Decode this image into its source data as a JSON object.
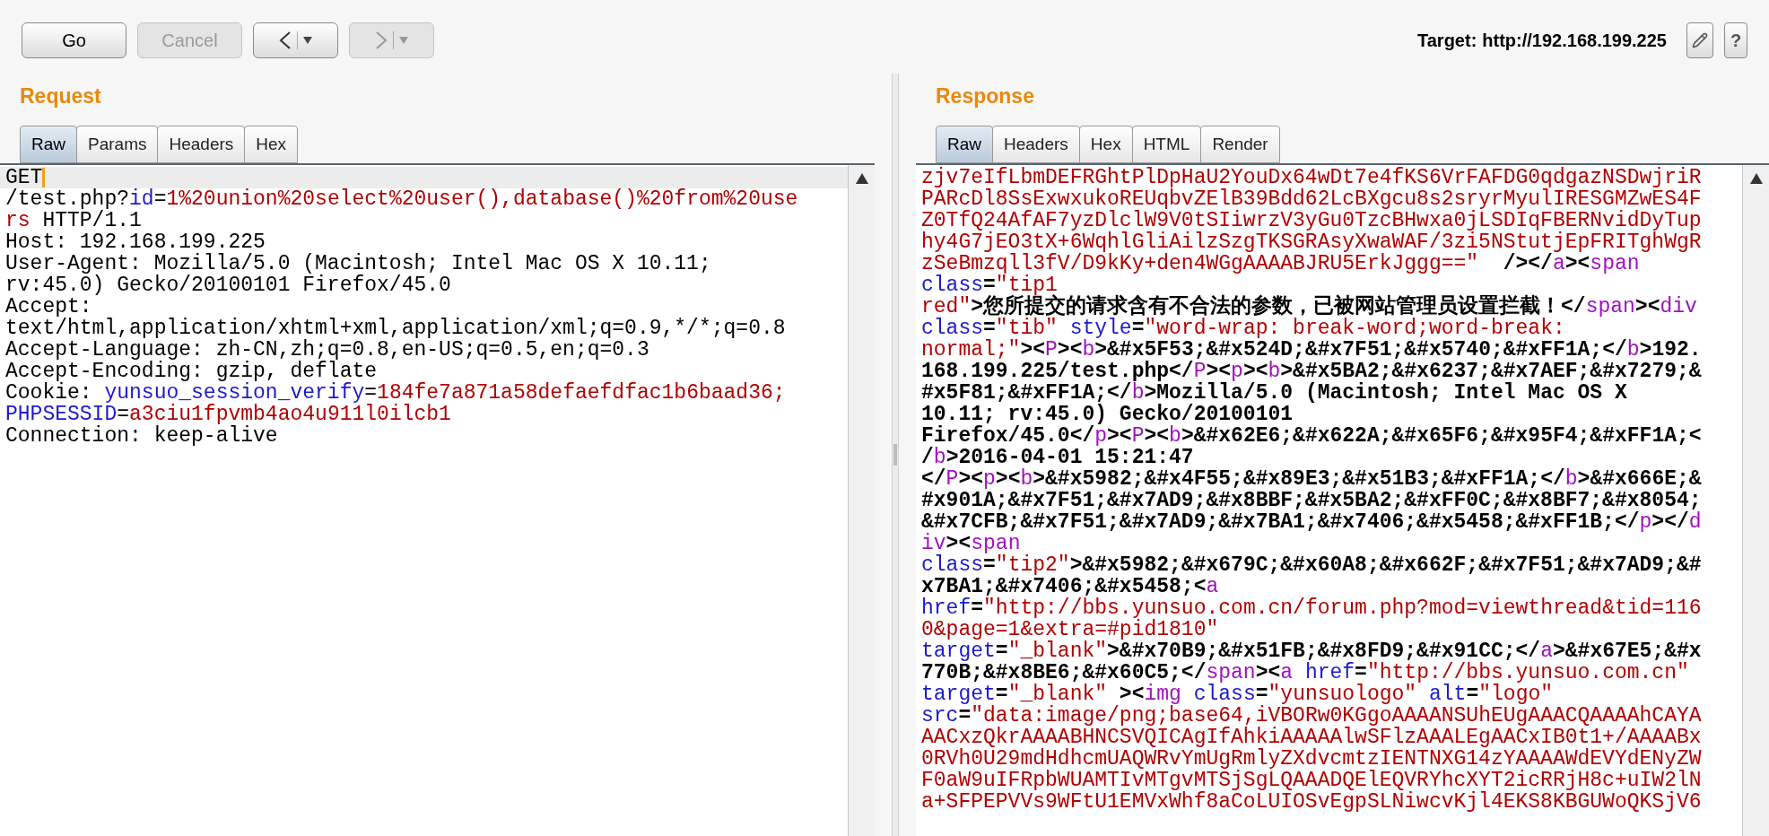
{
  "toolbar": {
    "buttons": [
      {
        "label": "Go",
        "disabled": false
      },
      {
        "label": "Cancel",
        "disabled": true
      }
    ],
    "nav": [
      {
        "kind": "back",
        "disabled": false
      },
      {
        "kind": "forward",
        "disabled": true
      }
    ],
    "target_label": "Target:",
    "target_url": "http://192.168.199.225",
    "help": "?"
  },
  "request": {
    "title": "Request",
    "tabs": [
      {
        "label": "Raw",
        "selected": true
      },
      {
        "label": "Params",
        "selected": false
      },
      {
        "label": "Headers",
        "selected": false
      },
      {
        "label": "Hex",
        "selected": false
      }
    ],
    "lines": [
      {
        "current": true,
        "segments": [
          {
            "kind": "text",
            "text": "GET"
          }
        ]
      },
      {
        "current": false,
        "segments": [
          {
            "kind": "text",
            "text": "/test.php?"
          },
          {
            "kind": "attr",
            "text": "id"
          },
          {
            "kind": "text",
            "text": "="
          },
          {
            "kind": "value",
            "text": "1%20union%20select%20user(),database()%20from%20use"
          }
        ]
      },
      {
        "current": false,
        "segments": [
          {
            "kind": "value",
            "text": "rs"
          },
          {
            "kind": "text",
            "text": " HTTP/1.1"
          }
        ]
      },
      {
        "current": false,
        "segments": [
          {
            "kind": "text",
            "text": "Host: 192.168.199.225"
          }
        ]
      },
      {
        "current": false,
        "segments": [
          {
            "kind": "text",
            "text": "User-Agent: Mozilla/5.0 (Macintosh; Intel Mac OS X 10.11;"
          }
        ]
      },
      {
        "current": false,
        "segments": [
          {
            "kind": "text",
            "text": "rv:45.0) Gecko/20100101 Firefox/45.0"
          }
        ]
      },
      {
        "current": false,
        "segments": [
          {
            "kind": "text",
            "text": "Accept:"
          }
        ]
      },
      {
        "current": false,
        "segments": [
          {
            "kind": "text",
            "text": "text/html,application/xhtml+xml,application/xml;q=0.9,*/*;q=0.8"
          }
        ]
      },
      {
        "current": false,
        "segments": [
          {
            "kind": "text",
            "text": "Accept-Language: zh-CN,zh;q=0.8,en-US;q=0.5,en;q=0.3"
          }
        ]
      },
      {
        "current": false,
        "segments": [
          {
            "kind": "text",
            "text": "Accept-Encoding: gzip, deflate"
          }
        ]
      },
      {
        "current": false,
        "segments": [
          {
            "kind": "text",
            "text": "Cookie: "
          },
          {
            "kind": "attr",
            "text": "yunsuo_session_verify"
          },
          {
            "kind": "text",
            "text": "="
          },
          {
            "kind": "value",
            "text": "184fe7a871a58defaefdfac1b6baad36;"
          }
        ]
      },
      {
        "current": false,
        "segments": [
          {
            "kind": "attr",
            "text": "PHPSESSID"
          },
          {
            "kind": "text",
            "text": "="
          },
          {
            "kind": "value",
            "text": "a3ciu1fpvmb4ao4u911l0ilcb1"
          }
        ]
      },
      {
        "current": false,
        "segments": [
          {
            "kind": "text",
            "text": "Connection: keep-alive"
          }
        ]
      }
    ]
  },
  "response": {
    "title": "Response",
    "tabs": [
      {
        "label": "Raw",
        "selected": true
      },
      {
        "label": "Headers",
        "selected": false
      },
      {
        "label": "Hex",
        "selected": false
      },
      {
        "label": "HTML",
        "selected": false
      },
      {
        "label": "Render",
        "selected": false
      }
    ],
    "lines": [
      {
        "segments": [
          {
            "kind": "value",
            "text": "zjv7eIfLbmDEFRGhtPlDpHaU2YouDx64wDt7e4fKS6VrFAFDG0qdgazNSDwjriR"
          }
        ]
      },
      {
        "segments": [
          {
            "kind": "value",
            "text": "PARcDl8SsExwxukoREUqbvZElB39Bdd62LcBXgcu8s2sryrMyulIRESGMZwES4F"
          }
        ]
      },
      {
        "segments": [
          {
            "kind": "value",
            "text": "Z0TfQ24AfAF7yzDlclW9V0tSIiwrzV3yGu0TzcBHwxa0jLSDIqFBERNvidDyTup"
          }
        ]
      },
      {
        "segments": [
          {
            "kind": "value",
            "text": "hy4G7jEO3tX+6WqhlGliAilzSzgTKSGRAsyXwaWAF/3zi5NStutjEpFRITghWgR"
          }
        ]
      },
      {
        "segments": [
          {
            "kind": "value",
            "text": "zSeBmzqll3fV/D9kKy+den4WGgAAAABJRU5ErkJggg==\""
          },
          {
            "kind": "text",
            "text": "  /></"
          },
          {
            "kind": "tag",
            "text": "a"
          },
          {
            "kind": "text",
            "text": "><"
          },
          {
            "kind": "tag",
            "text": "span"
          }
        ]
      },
      {
        "segments": [
          {
            "kind": "attr",
            "text": "class"
          },
          {
            "kind": "text",
            "text": "="
          },
          {
            "kind": "value",
            "text": "\"tip1"
          }
        ]
      },
      {
        "segments": [
          {
            "kind": "value",
            "text": "red\""
          },
          {
            "kind": "text",
            "text": ">您所提交的请求含有不合法的参数，已被网站管理员设置拦截！</"
          },
          {
            "kind": "tag",
            "text": "span"
          },
          {
            "kind": "text",
            "text": "><"
          },
          {
            "kind": "tag",
            "text": "div"
          }
        ]
      },
      {
        "segments": [
          {
            "kind": "attr",
            "text": "class"
          },
          {
            "kind": "text",
            "text": "="
          },
          {
            "kind": "value",
            "text": "\"tib\""
          },
          {
            "kind": "attr",
            "text": " style"
          },
          {
            "kind": "text",
            "text": "="
          },
          {
            "kind": "value",
            "text": "\"word-wrap: break-word;word-break:"
          }
        ]
      },
      {
        "segments": [
          {
            "kind": "value",
            "text": "normal;\""
          },
          {
            "kind": "text",
            "text": "><"
          },
          {
            "kind": "tag",
            "text": "P"
          },
          {
            "kind": "text",
            "text": "><"
          },
          {
            "kind": "tag",
            "text": "b"
          },
          {
            "kind": "text",
            "text": ">&#x5F53;&#x524D;&#x7F51;&#x5740;&#xFF1A;</"
          },
          {
            "kind": "tag",
            "text": "b"
          },
          {
            "kind": "text",
            "text": ">192."
          }
        ]
      },
      {
        "segments": [
          {
            "kind": "text",
            "text": "168.199.225/test.php</"
          },
          {
            "kind": "tag",
            "text": "P"
          },
          {
            "kind": "text",
            "text": "><"
          },
          {
            "kind": "tag",
            "text": "p"
          },
          {
            "kind": "text",
            "text": "><"
          },
          {
            "kind": "tag",
            "text": "b"
          },
          {
            "kind": "text",
            "text": ">&#x5BA2;&#x6237;&#x7AEF;&#x7279;&"
          }
        ]
      },
      {
        "segments": [
          {
            "kind": "text",
            "text": "#x5F81;&#xFF1A;</"
          },
          {
            "kind": "tag",
            "text": "b"
          },
          {
            "kind": "text",
            "text": ">Mozilla/5.0 (Macintosh; Intel Mac OS X"
          }
        ]
      },
      {
        "segments": [
          {
            "kind": "text",
            "text": "10.11; rv:45.0) Gecko/20100101"
          }
        ]
      },
      {
        "segments": [
          {
            "kind": "text",
            "text": "Firefox/45.0</"
          },
          {
            "kind": "tag",
            "text": "p"
          },
          {
            "kind": "text",
            "text": "><"
          },
          {
            "kind": "tag",
            "text": "P"
          },
          {
            "kind": "text",
            "text": "><"
          },
          {
            "kind": "tag",
            "text": "b"
          },
          {
            "kind": "text",
            "text": ">&#x62E6;&#x622A;&#x65F6;&#x95F4;&#xFF1A;<"
          }
        ]
      },
      {
        "segments": [
          {
            "kind": "text",
            "text": "/"
          },
          {
            "kind": "tag",
            "text": "b"
          },
          {
            "kind": "text",
            "text": ">2016-04-01 15:21:47"
          }
        ]
      },
      {
        "segments": [
          {
            "kind": "text",
            "text": "</"
          },
          {
            "kind": "tag",
            "text": "P"
          },
          {
            "kind": "text",
            "text": "><"
          },
          {
            "kind": "tag",
            "text": "p"
          },
          {
            "kind": "text",
            "text": "><"
          },
          {
            "kind": "tag",
            "text": "b"
          },
          {
            "kind": "text",
            "text": ">&#x5982;&#x4F55;&#x89E3;&#x51B3;&#xFF1A;</"
          },
          {
            "kind": "tag",
            "text": "b"
          },
          {
            "kind": "text",
            "text": ">&#x666E;&"
          }
        ]
      },
      {
        "segments": [
          {
            "kind": "text",
            "text": "#x901A;&#x7F51;&#x7AD9;&#x8BBF;&#x5BA2;&#xFF0C;&#x8BF7;&#x8054;"
          }
        ]
      },
      {
        "segments": [
          {
            "kind": "text",
            "text": "&#x7CFB;&#x7F51;&#x7AD9;&#x7BA1;&#x7406;&#x5458;&#xFF1B;</"
          },
          {
            "kind": "tag",
            "text": "p"
          },
          {
            "kind": "text",
            "text": "></"
          },
          {
            "kind": "tag",
            "text": "d"
          }
        ]
      },
      {
        "segments": [
          {
            "kind": "tag",
            "text": "iv"
          },
          {
            "kind": "text",
            "text": "><"
          },
          {
            "kind": "tag",
            "text": "span"
          }
        ]
      },
      {
        "segments": [
          {
            "kind": "attr",
            "text": "class"
          },
          {
            "kind": "text",
            "text": "="
          },
          {
            "kind": "value",
            "text": "\"tip2\""
          },
          {
            "kind": "text",
            "text": ">&#x5982;&#x679C;&#x60A8;&#x662F;&#x7F51;&#x7AD9;&#"
          }
        ]
      },
      {
        "segments": [
          {
            "kind": "text",
            "text": "x7BA1;&#x7406;&#x5458;<"
          },
          {
            "kind": "tag",
            "text": "a"
          }
        ]
      },
      {
        "segments": [
          {
            "kind": "attr",
            "text": "href"
          },
          {
            "kind": "text",
            "text": "="
          },
          {
            "kind": "value",
            "text": "\"http://bbs.yunsuo.com.cn/forum.php?mod=viewthread&tid=116"
          }
        ]
      },
      {
        "segments": [
          {
            "kind": "value",
            "text": "0&page=1&extra=#pid1810\""
          }
        ]
      },
      {
        "segments": [
          {
            "kind": "attr",
            "text": "target"
          },
          {
            "kind": "text",
            "text": "="
          },
          {
            "kind": "value",
            "text": "\"_blank\""
          },
          {
            "kind": "text",
            "text": ">&#x70B9;&#x51FB;&#x8FD9;&#x91CC;</"
          },
          {
            "kind": "tag",
            "text": "a"
          },
          {
            "kind": "text",
            "text": ">&#x67E5;&#x"
          }
        ]
      },
      {
        "segments": [
          {
            "kind": "text",
            "text": "770B;&#x8BE6;&#x60C5;</"
          },
          {
            "kind": "tag",
            "text": "span"
          },
          {
            "kind": "text",
            "text": "><"
          },
          {
            "kind": "tag",
            "text": "a"
          },
          {
            "kind": "attr",
            "text": " href"
          },
          {
            "kind": "text",
            "text": "="
          },
          {
            "kind": "value",
            "text": "\"http://bbs.yunsuo.com.cn\""
          }
        ]
      },
      {
        "segments": [
          {
            "kind": "attr",
            "text": "target"
          },
          {
            "kind": "text",
            "text": "="
          },
          {
            "kind": "value",
            "text": "\"_blank\""
          },
          {
            "kind": "text",
            "text": " ><"
          },
          {
            "kind": "tag",
            "text": "img"
          },
          {
            "kind": "attr",
            "text": " class"
          },
          {
            "kind": "text",
            "text": "="
          },
          {
            "kind": "value",
            "text": "\"yunsuologo\""
          },
          {
            "kind": "attr",
            "text": " alt"
          },
          {
            "kind": "text",
            "text": "="
          },
          {
            "kind": "value",
            "text": "\"logo\""
          }
        ]
      },
      {
        "segments": [
          {
            "kind": "attr",
            "text": "src"
          },
          {
            "kind": "text",
            "text": "="
          },
          {
            "kind": "value",
            "text": "\"data:image/png;base64,iVBORw0KGgoAAAANSUhEUgAAACQAAAAhCAYA"
          }
        ]
      },
      {
        "segments": [
          {
            "kind": "value",
            "text": "AACxzQkrAAAABHNCSVQICAgIfAhkiAAAAAlwSFlzAAALEgAACxIB0t1+/AAAABx"
          }
        ]
      },
      {
        "segments": [
          {
            "kind": "value",
            "text": "0RVh0U29mdHdhcmUAQWRvYmUgRmlyZXdvcmtzIENTNXG14zYAAAAWdEVYdENyZW"
          }
        ]
      },
      {
        "segments": [
          {
            "kind": "value",
            "text": "F0aW9uIFRpbWUAMTIvMTgvMTSjSgLQAAADQElEQVRYhcXYT2icRRjH8c+uIW2lN"
          }
        ]
      },
      {
        "segments": [
          {
            "kind": "value",
            "text": "a+SFPEPVVs9WFtU1EMVxWhf8aCoLUIOSvEgpSLNiwcvKjl4EKS8KBGUWoQKSjV6"
          }
        ]
      }
    ]
  }
}
